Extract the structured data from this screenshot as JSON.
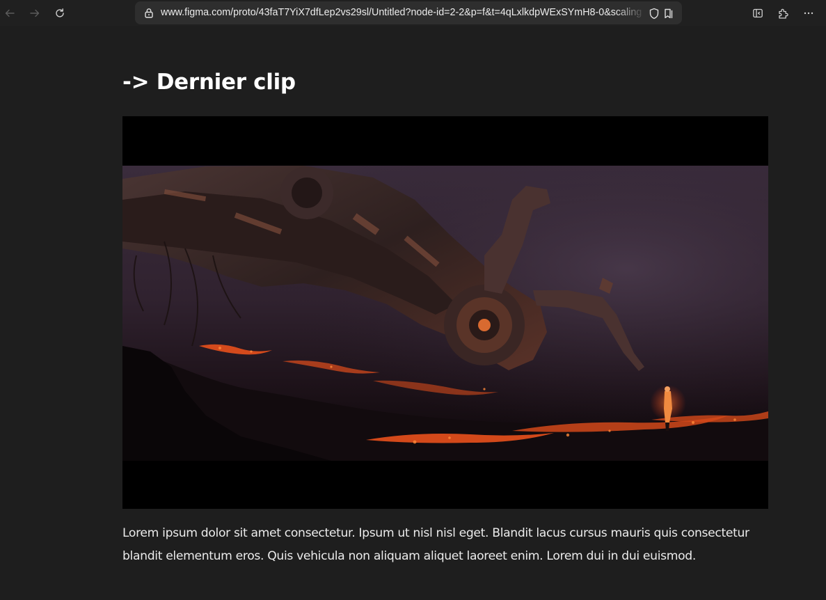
{
  "browser": {
    "url": "www.figma.com/proto/43faT7YiX7dfLep2vs29sl/Untitled?node-id=2-2&p=f&t=4qLxlkdpWExSYmH8-0&scaling",
    "back_icon": "arrow-left-icon",
    "forward_icon": "arrow-right-icon",
    "reload_icon": "reload-icon",
    "lock_icon": "lock-icon",
    "tracking_icon": "shield-icon",
    "reading_list_icon": "bookmark-icon",
    "sidebar_icon": "sidebar-icon",
    "extensions_icon": "puzzle-icon",
    "menu_icon": "more-horizontal-icon"
  },
  "page": {
    "heading": "-> Dernier clip",
    "video_thumbnail": "giant-mechanical-robot-over-lava-field-still",
    "description": "Lorem ipsum dolor sit amet consectetur. Ipsum ut nisl nisl eget. Blandit lacus cursus mauris quis consectetur blandit elementum eros. Quis vehicula non aliquam aliquet laoreet enim. Lorem dui in dui euismod."
  },
  "colors": {
    "page_background": "#1e1e1e",
    "toolbar_background": "#202020",
    "address_bar_background": "#2e2e2e",
    "heading_text": "#ffffff",
    "body_text": "#ebebeb",
    "letterbox": "#000000",
    "lava_accent": "#e8501c"
  }
}
